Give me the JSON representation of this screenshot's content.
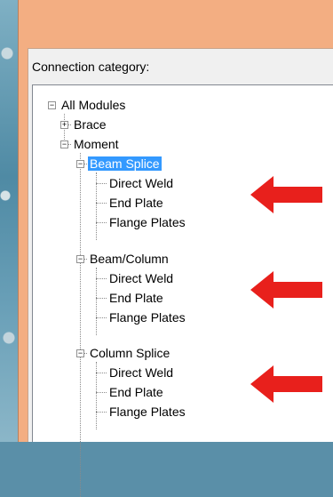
{
  "dialog": {
    "group_label": "Connection category:"
  },
  "tree": {
    "root": {
      "label": "All Modules",
      "expanded": true
    },
    "brace": {
      "label": "Brace",
      "expanded": false
    },
    "moment": {
      "label": "Moment",
      "expanded": true
    },
    "beam_splice": {
      "label": "Beam Splice",
      "expanded": true,
      "selected": true,
      "children": [
        "Direct Weld",
        "End Plate",
        "Flange Plates"
      ]
    },
    "beam_column": {
      "label": "Beam/Column",
      "expanded": true,
      "children": [
        "Direct Weld",
        "End Plate",
        "Flange Plates"
      ]
    },
    "column_splice": {
      "label": "Column Splice",
      "expanded": true,
      "children": [
        "Direct Weld",
        "End Plate",
        "Flange Plates"
      ]
    }
  },
  "annotation": {
    "arrow_color": "#e8201c",
    "arrow_icon": "red-arrow-left-icon"
  }
}
